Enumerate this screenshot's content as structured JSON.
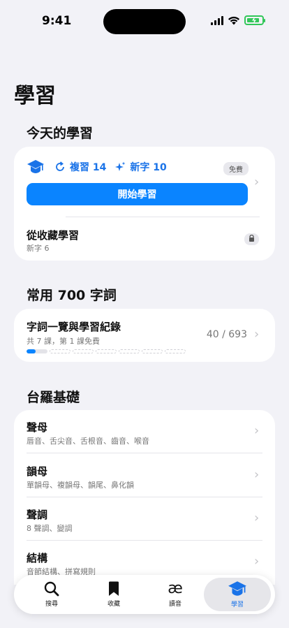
{
  "status": {
    "time": "9:41"
  },
  "page_title": "學習",
  "today": {
    "section_title": "今天的學習",
    "review_label": "複習 14",
    "new_label": "新字 10",
    "free_badge": "免費",
    "start_button": "開始學習",
    "favorites_title": "從收藏學習",
    "favorites_sub": "新字 6"
  },
  "common": {
    "section_title": "常用 700 字詞",
    "row_title": "字詞一覽與學習紀錄",
    "row_sub": "共 7 課，第 1 課免費",
    "progress_text": "40 / 693",
    "lessons_total": 7,
    "progress_fraction": 0.058
  },
  "basics": {
    "section_title": "台羅基礎",
    "items": [
      {
        "title": "聲母",
        "sub": "唇音、舌尖音、舌根音、齒音、喉音"
      },
      {
        "title": "韻母",
        "sub": "單韻母、複韻母、韻尾、鼻化韻"
      },
      {
        "title": "聲調",
        "sub": "8 聲調、變調"
      },
      {
        "title": "結構",
        "sub": "音節結構、拼寫規則"
      }
    ]
  },
  "tabbar": {
    "tabs": [
      {
        "label": "搜尋",
        "icon": "search-icon"
      },
      {
        "label": "收藏",
        "icon": "bookmark-icon"
      },
      {
        "label": "讀音",
        "icon": "ae-ligature-icon",
        "glyph": "æ"
      },
      {
        "label": "學習",
        "icon": "graduation-cap-icon",
        "active": true
      }
    ]
  },
  "colors": {
    "accent": "#0a84ff",
    "background": "#f2f2f7",
    "battery": "#32c759"
  }
}
